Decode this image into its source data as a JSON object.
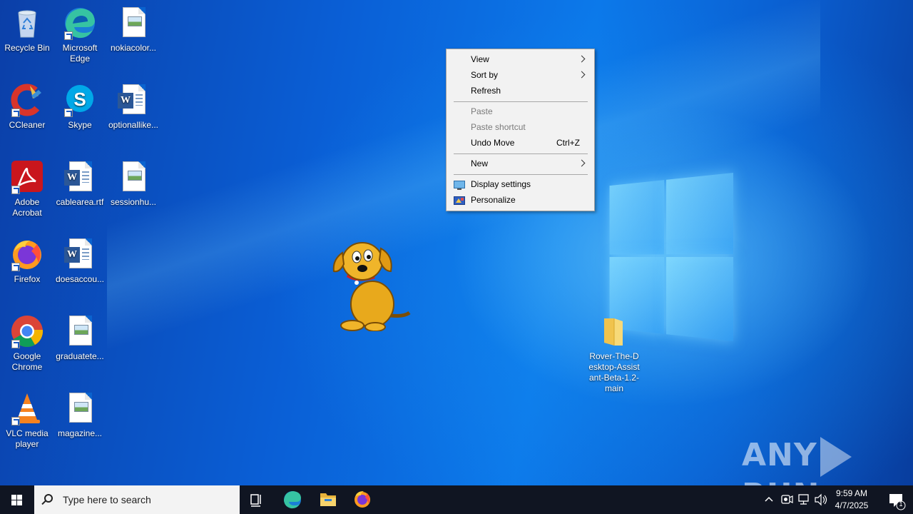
{
  "desktop": {
    "icons": [
      {
        "label": "Recycle Bin",
        "icon": "recycle-bin-icon"
      },
      {
        "label": "Microsoft Edge",
        "icon": "edge-icon"
      },
      {
        "label": "nokiacolor...",
        "icon": "image-file-icon"
      },
      {
        "label": "CCleaner",
        "icon": "ccleaner-icon"
      },
      {
        "label": "Skype",
        "icon": "skype-icon"
      },
      {
        "label": "optionallike...",
        "icon": "word-document-icon"
      },
      {
        "label": "Adobe Acrobat",
        "icon": "acrobat-icon"
      },
      {
        "label": "cablearea.rtf",
        "icon": "word-document-icon"
      },
      {
        "label": "sessionhu...",
        "icon": "image-file-icon"
      },
      {
        "label": "Firefox",
        "icon": "firefox-icon"
      },
      {
        "label": "doesaccou...",
        "icon": "word-document-icon"
      },
      {
        "label": "Google Chrome",
        "icon": "chrome-icon"
      },
      {
        "label": "graduatete...",
        "icon": "image-file-icon"
      },
      {
        "label": "VLC media player",
        "icon": "vlc-icon"
      },
      {
        "label": "magazine...",
        "icon": "image-file-icon"
      },
      {
        "label": "Rover-The-Desktop-Assistant-Beta-1.2-main",
        "icon": "folder-icon"
      }
    ]
  },
  "context_menu": {
    "items": [
      {
        "label": "View",
        "submenu": true
      },
      {
        "label": "Sort by",
        "submenu": true
      },
      {
        "label": "Refresh"
      },
      {
        "label": "Paste",
        "disabled": true
      },
      {
        "label": "Paste shortcut",
        "disabled": true
      },
      {
        "label": "Undo Move",
        "shortcut": "Ctrl+Z"
      },
      {
        "label": "New",
        "submenu": true
      },
      {
        "label": "Display settings",
        "icon": "display-settings-icon"
      },
      {
        "label": "Personalize",
        "icon": "personalize-icon"
      }
    ]
  },
  "taskbar": {
    "search_placeholder": "Type here to search",
    "pinned": [
      "task-view-icon",
      "edge-icon",
      "file-explorer-icon",
      "firefox-icon"
    ],
    "tray_icons": [
      "chevron-up-icon",
      "meet-now-icon",
      "network-icon",
      "volume-icon"
    ],
    "time": "9:59 AM",
    "date": "4/7/2025",
    "notification_count": "1"
  },
  "watermark": {
    "left": "ANY",
    "right": "RUN"
  },
  "colors": {
    "taskbar": "#101522",
    "menu_bg": "#f2f2f2",
    "desktop_blue": "#0a63cf"
  }
}
